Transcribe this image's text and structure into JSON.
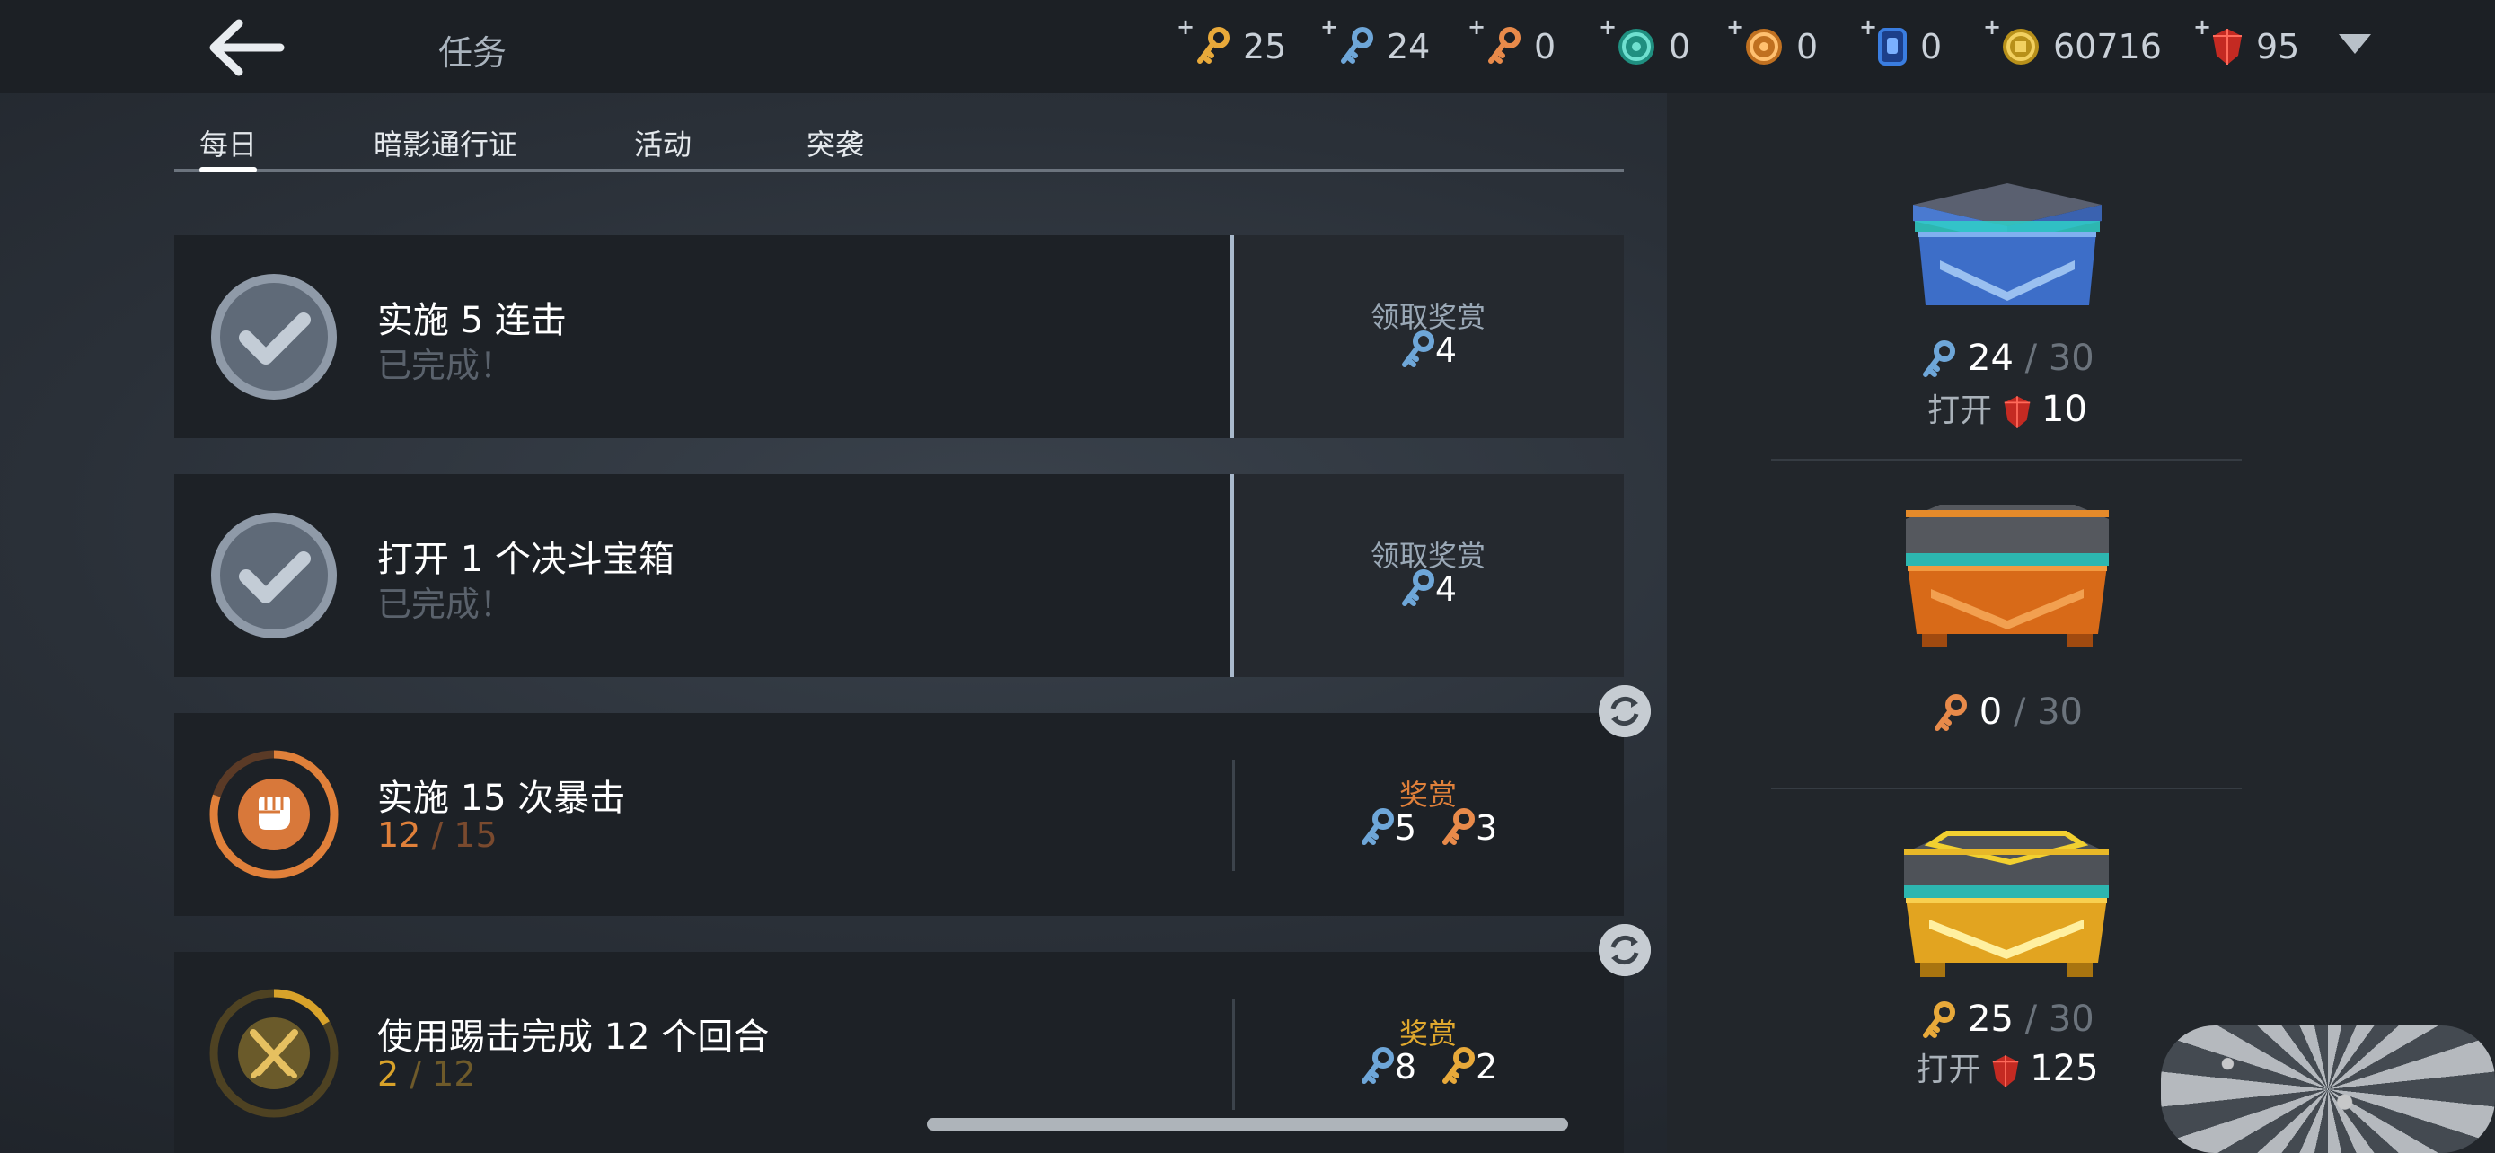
{
  "header": {
    "title": "任务",
    "currencies": [
      {
        "icon": "gold-key-icon",
        "plus": "+",
        "value": "25",
        "color": "#e8a93a"
      },
      {
        "icon": "blue-key-icon",
        "plus": "+",
        "value": "24",
        "color": "#6ea6d8"
      },
      {
        "icon": "orange-key-icon",
        "plus": "+",
        "value": "0",
        "color": "#e88a4a"
      },
      {
        "icon": "teal-orb-icon",
        "plus": "+",
        "value": "0",
        "color": "#2fb5a0"
      },
      {
        "icon": "orange-orb-icon",
        "plus": "+",
        "value": "0",
        "color": "#e89538"
      },
      {
        "icon": "blue-card-icon",
        "plus": "+",
        "value": "0",
        "color": "#3a7de0"
      },
      {
        "icon": "coin-icon",
        "plus": "+",
        "value": "60716",
        "color": "#e0b83a"
      },
      {
        "icon": "ruby-icon",
        "plus": "+",
        "value": "95",
        "color": "#d8382c"
      }
    ]
  },
  "tabs": [
    {
      "label": "每日",
      "active": true
    },
    {
      "label": "暗影通行证",
      "active": false
    },
    {
      "label": "活动",
      "active": false
    },
    {
      "label": "突袭",
      "active": false
    }
  ],
  "tasks": [
    {
      "title": "实施 5 连击",
      "status": "已完成！",
      "reward_label": "领取奖赏",
      "rewards": [
        {
          "icon": "blue-key-icon",
          "amount": "4"
        }
      ]
    },
    {
      "title": "打开 1 个决斗宝箱",
      "status": "已完成！",
      "reward_label": "领取奖赏",
      "rewards": [
        {
          "icon": "blue-key-icon",
          "amount": "4"
        }
      ]
    },
    {
      "title": "实施 15 次暴击",
      "progress_current": "12",
      "progress_sep": " / ",
      "progress_total": "15",
      "progress_fraction": 0.8,
      "accent": "#e0803a",
      "reward_label": "奖赏",
      "rewards": [
        {
          "icon": "blue-key-icon",
          "amount": "5"
        },
        {
          "icon": "orange-key-icon",
          "amount": "3"
        }
      ]
    },
    {
      "title": "使用踢击完成 12 个回合",
      "progress_current": "2",
      "progress_sep": " / ",
      "progress_total": "12",
      "progress_fraction": 0.1667,
      "accent": "#d8a22a",
      "reward_label": "奖赏",
      "rewards": [
        {
          "icon": "blue-key-icon",
          "amount": "8"
        },
        {
          "icon": "gold-key-icon",
          "amount": "2"
        }
      ]
    }
  ],
  "chests": [
    {
      "name": "blue-chest",
      "key_icon": "blue-key-icon",
      "current": "24",
      "sep": " / ",
      "max": "30",
      "open_label": "打开",
      "open_cost": "10"
    },
    {
      "name": "orange-chest",
      "key_icon": "orange-key-icon",
      "current": "0",
      "sep": " / ",
      "max": "30"
    },
    {
      "name": "gold-chest",
      "key_icon": "gold-key-icon",
      "current": "25",
      "sep": " / ",
      "max": "30",
      "open_label": "打开",
      "open_cost": "125"
    }
  ]
}
